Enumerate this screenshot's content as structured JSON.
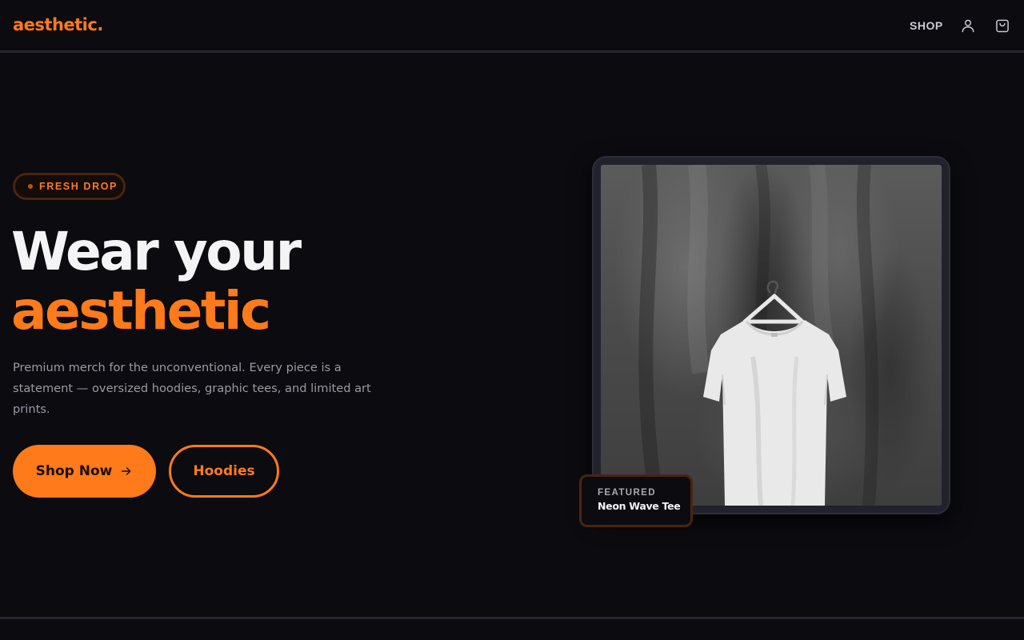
{
  "header": {
    "logo": "aesthetic.",
    "nav": {
      "shop_label": "SHOP"
    },
    "icons": [
      "user-icon",
      "shopping-bag-icon"
    ]
  },
  "hero": {
    "badge": "FRESH DROP",
    "headline_line1": "Wear your",
    "headline_line2": "aesthetic",
    "description": "Premium merch for the unconventional. Every piece is a statement — oversized hoodies, graphic tees, and limited art prints.",
    "primary_button": "Shop Now",
    "secondary_button": "Hoodies"
  },
  "featured": {
    "label": "FEATURED",
    "product_name": "Neon Wave Tee"
  },
  "colors": {
    "accent": "#ff7a1a",
    "background": "#0b0b10",
    "text": "#f4f4f6",
    "muted": "#9a9aa6"
  }
}
